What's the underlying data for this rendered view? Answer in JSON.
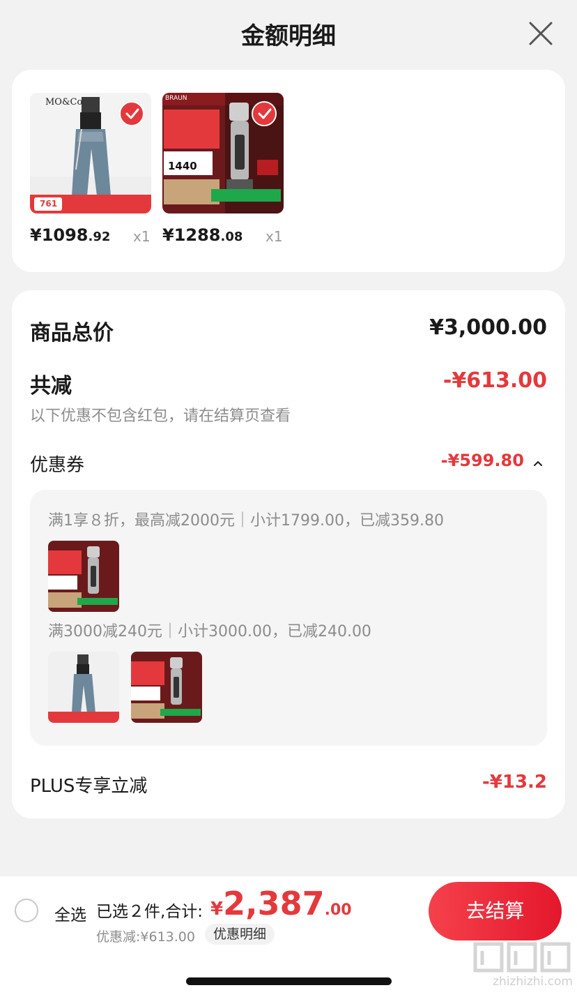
{
  "header": {
    "title": "金额明细",
    "close_icon": "close-icon"
  },
  "products": [
    {
      "brand_text": "MO&Co",
      "thumb_badge": "761",
      "price_int": "¥1098",
      "price_dec": ".92",
      "qty": "x1",
      "selected": true
    },
    {
      "brand_text": "BRAUN",
      "thumb_badge": "1440",
      "price_int": "¥1288",
      "price_dec": ".08",
      "qty": "x1",
      "selected": true
    }
  ],
  "summary": {
    "total_label": "商品总价",
    "total_value": "¥3,000.00",
    "reduce_label": "共减",
    "reduce_value": "-¥613.00",
    "note": "以下优惠不包含红包，请在结算页查看",
    "coupon_label": "优惠券",
    "coupon_value": "-¥599.80",
    "coupon_rule_1": "满1享８折，最高减2000元｜小计1799.00，已减359.80",
    "coupon_rule_2": "满3000减240元｜小计3000.00，已减240.00",
    "plus_label": "PLUS专享立减",
    "plus_value": "-¥13.2"
  },
  "bottom_bar": {
    "select_all": "全选",
    "selected_text": "已选２件,合计:",
    "total_currency": "¥",
    "total_int": "2,387",
    "total_dec": ".00",
    "discount_text": "优惠减:¥613.00",
    "detail_chip": "优惠明细",
    "checkout_label": "去结算"
  },
  "watermark": {
    "url": "zhizhizhi.com"
  },
  "colors": {
    "accent_red": "#e4393c",
    "background": "#f2f2f2"
  }
}
